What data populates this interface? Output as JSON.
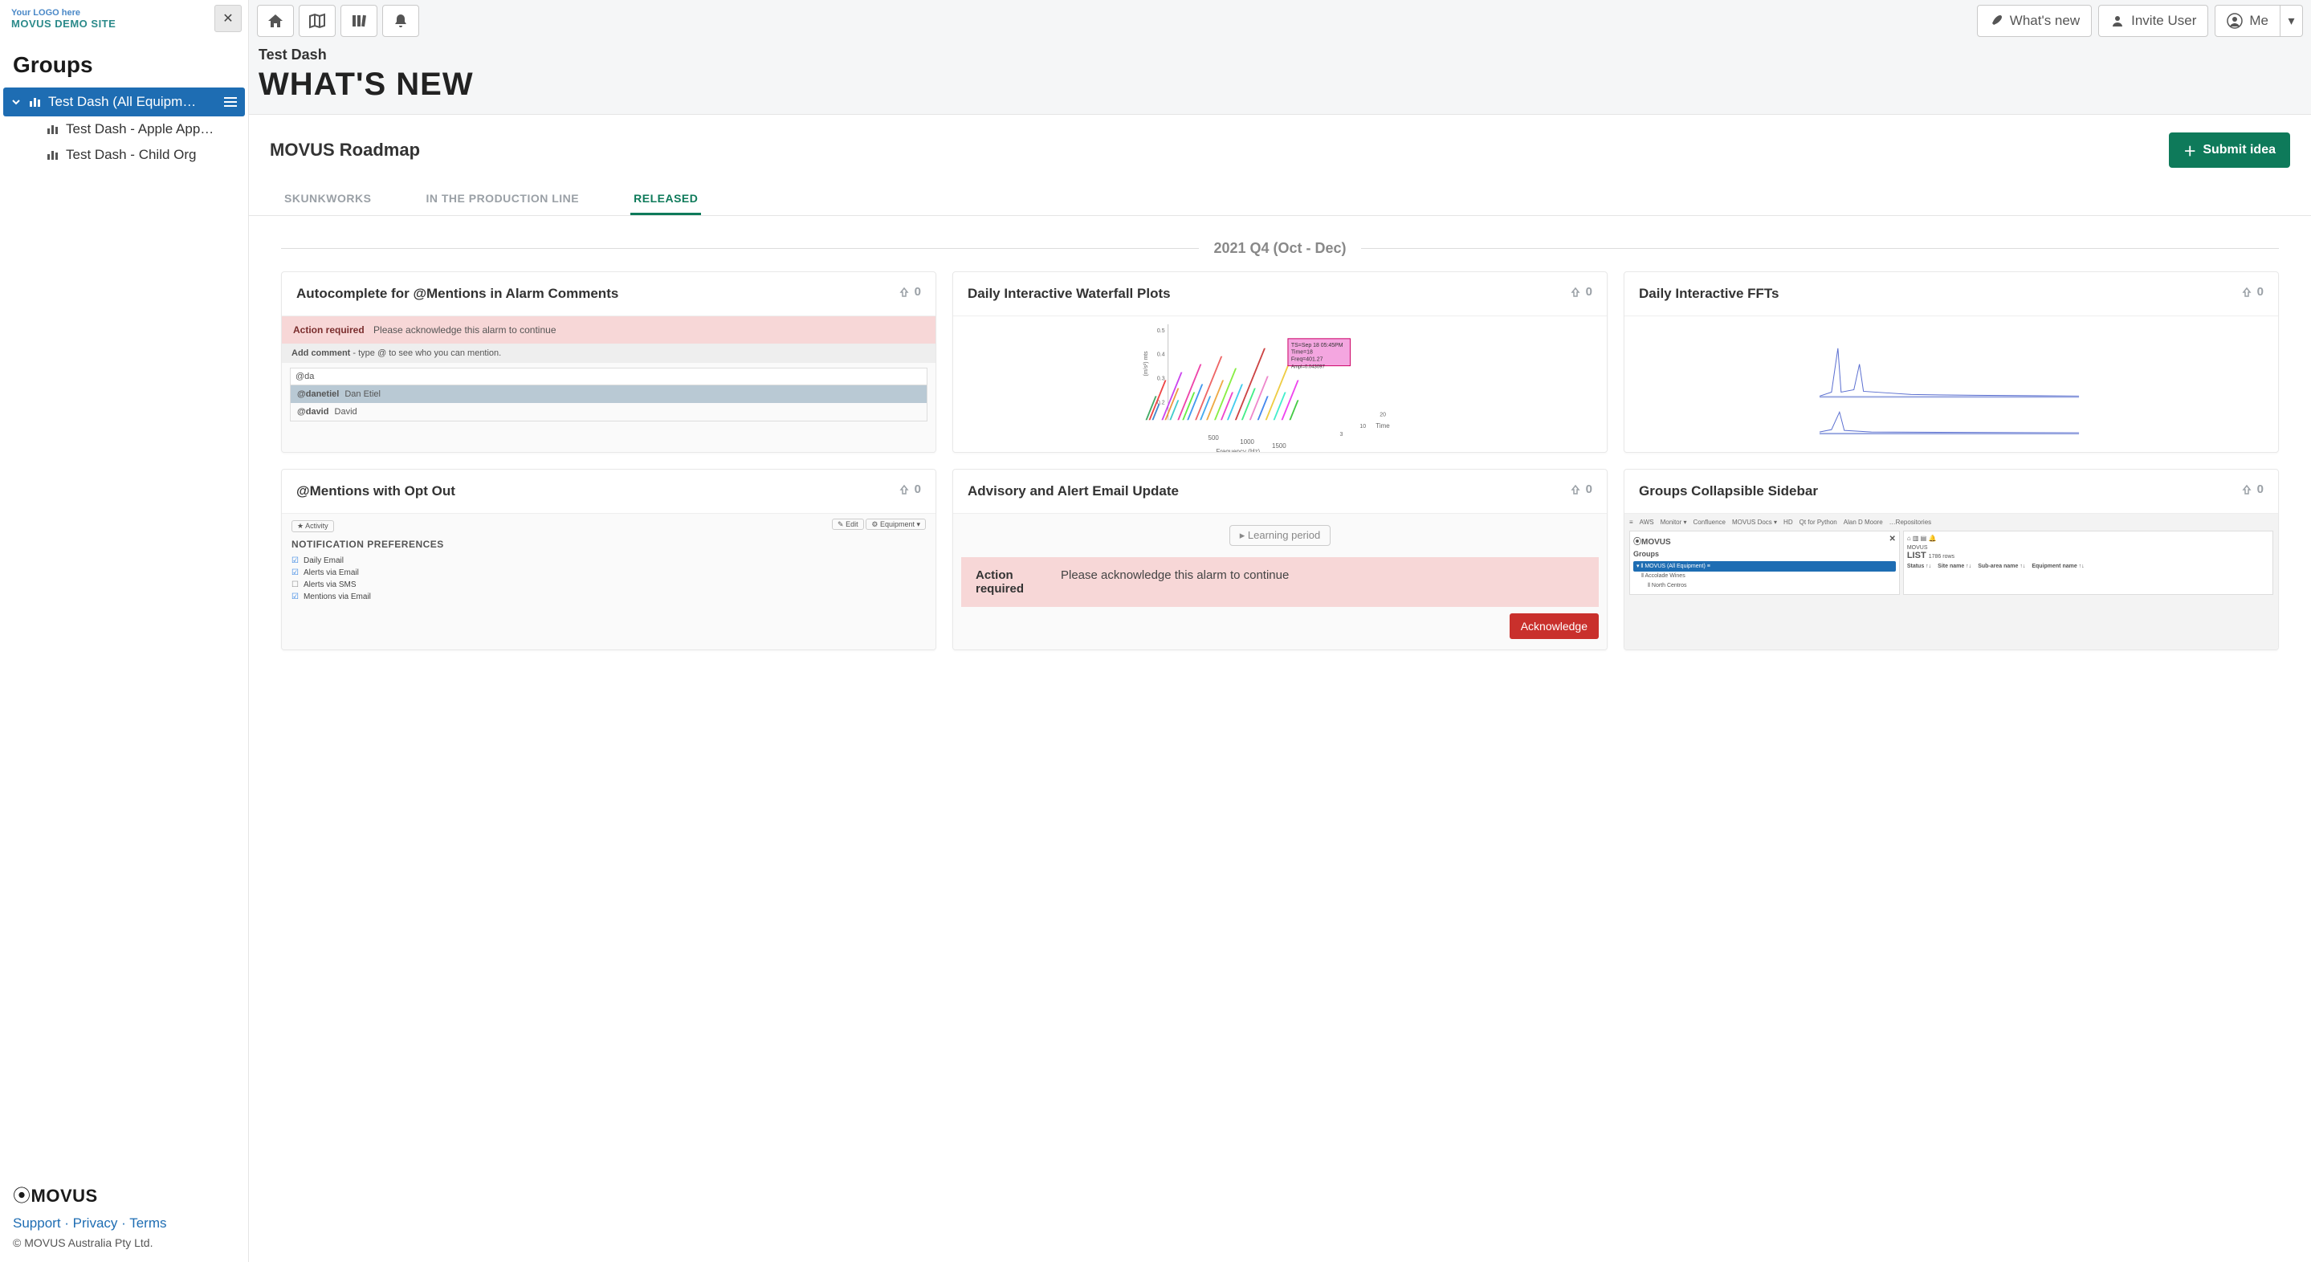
{
  "brand": {
    "logo_text": "Your LOGO here",
    "site_name": "MOVUS DEMO SITE",
    "footer_brand": "MOVUS"
  },
  "sidebar": {
    "heading": "Groups",
    "active": {
      "label": "Test Dash (All Equipm…"
    },
    "children": [
      {
        "label": "Test Dash - Apple App…"
      },
      {
        "label": "Test Dash - Child Org"
      }
    ],
    "footer_links": {
      "support": "Support",
      "privacy": "Privacy",
      "terms": "Terms"
    },
    "copyright": "© MOVUS Australia Pty Ltd."
  },
  "topbar": {
    "whats_new": "What's new",
    "invite": "Invite User",
    "me": "Me"
  },
  "page": {
    "breadcrumb": "Test Dash",
    "title": "WHAT'S NEW"
  },
  "roadmap": {
    "heading": "MOVUS Roadmap",
    "submit_label": "Submit idea",
    "tabs": [
      {
        "label": "SKUNKWORKS",
        "active": false
      },
      {
        "label": "IN THE PRODUCTION LINE",
        "active": false
      },
      {
        "label": "RELEASED",
        "active": true
      }
    ],
    "quarter": "2021 Q4 (Oct - Dec)",
    "cards": [
      {
        "title": "Autocomplete for @Mentions in Alarm Comments",
        "votes": "0",
        "preview": {
          "banner_label": "Action required",
          "banner_msg": "Please acknowledge this alarm to continue",
          "comment_label": "Add comment",
          "comment_hint": "- type @ to see who you can mention.",
          "input_value": "@da",
          "mentions": [
            {
              "handle": "@danetiel",
              "name": "Dan Etiel",
              "selected": true
            },
            {
              "handle": "@david",
              "name": "David",
              "selected": false
            }
          ]
        }
      },
      {
        "title": "Daily Interactive Waterfall Plots",
        "votes": "0"
      },
      {
        "title": "Daily Interactive FFTs",
        "votes": "0"
      },
      {
        "title": "@Mentions with Opt Out",
        "votes": "0",
        "preview": {
          "activity_tag": "Activity",
          "edit_tag": "Edit",
          "equip_tag": "Equipment",
          "section": "NOTIFICATION PREFERENCES",
          "items": [
            {
              "label": "Daily Email",
              "on": true
            },
            {
              "label": "Alerts via Email",
              "on": true
            },
            {
              "label": "Alerts via SMS",
              "on": false
            },
            {
              "label": "Mentions via Email",
              "on": true
            }
          ]
        }
      },
      {
        "title": "Advisory and Alert Email Update",
        "votes": "0",
        "preview": {
          "chip": "Learning period",
          "lbl": "Action required",
          "msg": "Please acknowledge this alarm to continue",
          "ack": "Acknowledge"
        }
      },
      {
        "title": "Groups Collapsible Sidebar",
        "votes": "0"
      }
    ]
  }
}
